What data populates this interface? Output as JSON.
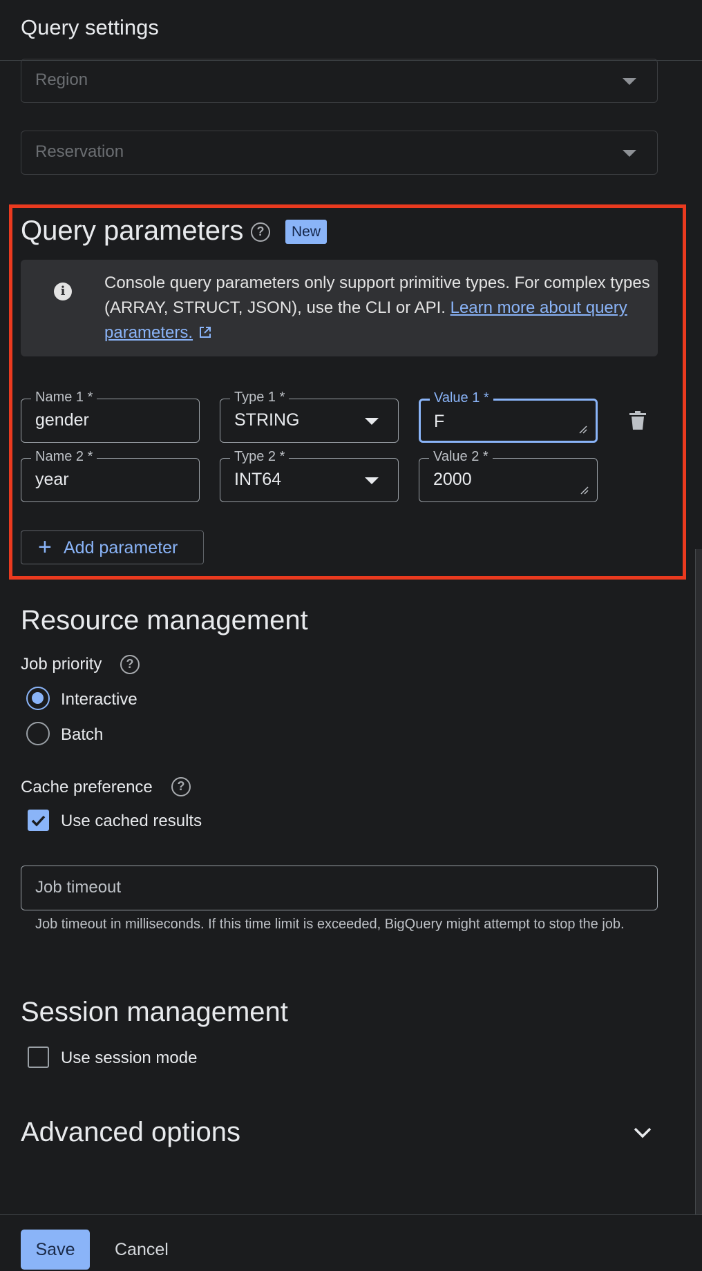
{
  "header": {
    "title": "Query settings"
  },
  "dropdowns": {
    "region": "Region",
    "reservation": "Reservation"
  },
  "query_parameters": {
    "title": "Query parameters",
    "badge": "New",
    "info": {
      "text": "Console query parameters only support primitive types. For complex types (ARRAY, STRUCT, JSON), use the CLI or API.",
      "link_text": "Learn more about query parameters."
    },
    "params": [
      {
        "name_label": "Name 1 *",
        "name_value": "gender",
        "type_label": "Type 1 *",
        "type_value": "STRING",
        "value_label": "Value 1 *",
        "value_value": "F"
      },
      {
        "name_label": "Name 2 *",
        "name_value": "year",
        "type_label": "Type 2 *",
        "type_value": "INT64",
        "value_label": "Value 2 *",
        "value_value": "2000"
      }
    ],
    "add_button": "Add parameter"
  },
  "resource_management": {
    "title": "Resource management",
    "job_priority": {
      "label": "Job priority",
      "options": [
        "Interactive",
        "Batch"
      ],
      "selected": "Interactive"
    },
    "cache_preference": {
      "label": "Cache preference",
      "checkbox_label": "Use cached results",
      "checked": true
    },
    "job_timeout": {
      "placeholder": "Job timeout",
      "hint": "Job timeout in milliseconds. If this time limit is exceeded, BigQuery might attempt to stop the job."
    }
  },
  "session_management": {
    "title": "Session management",
    "checkbox_label": "Use session mode",
    "checked": false
  },
  "advanced": {
    "title": "Advanced options"
  },
  "footer": {
    "save": "Save",
    "cancel": "Cancel"
  },
  "colors": {
    "accent": "#8ab4f8",
    "highlight_border": "#ea3a1f",
    "background": "#1b1c1e"
  }
}
